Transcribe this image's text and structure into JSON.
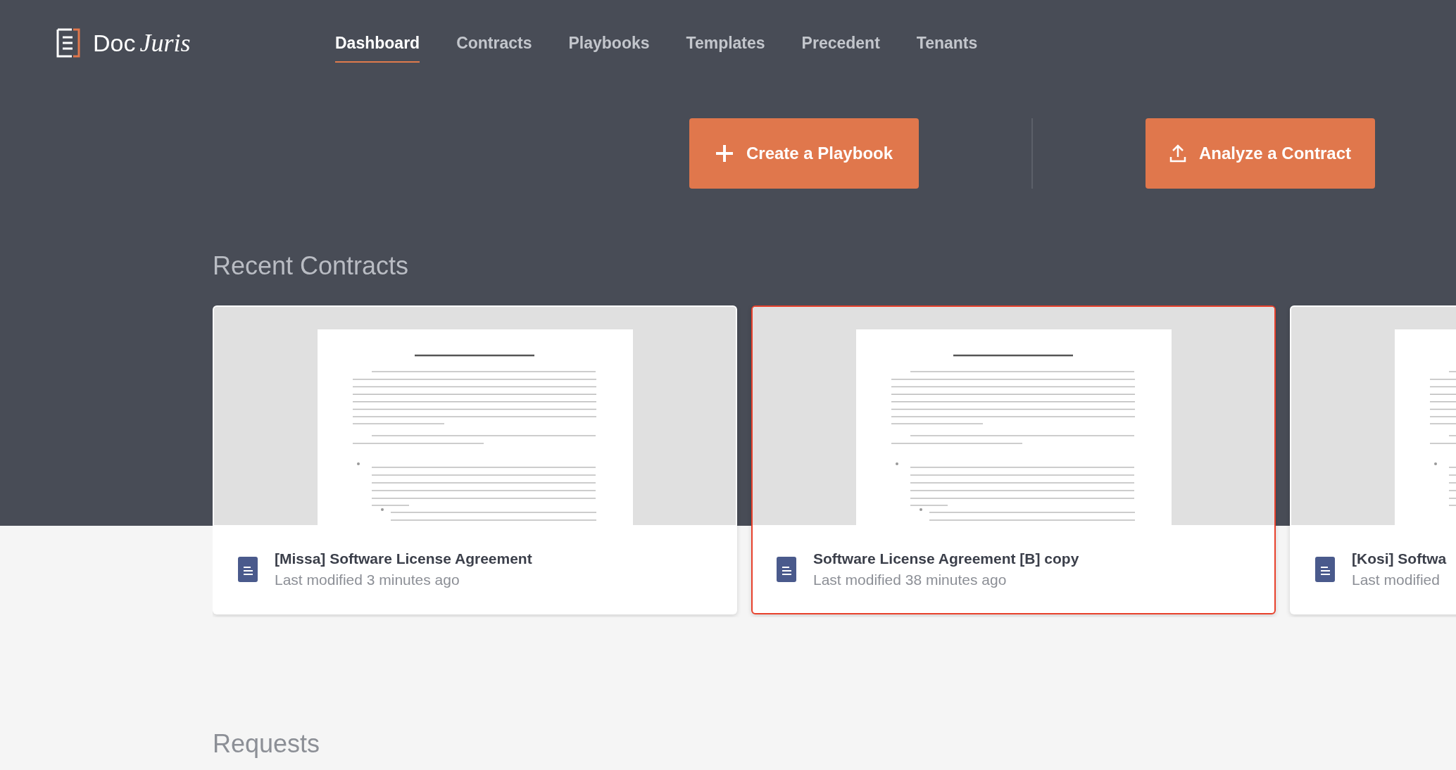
{
  "logo": {
    "first": "Doc",
    "second": "Juris"
  },
  "nav": [
    {
      "label": "Dashboard",
      "selected": true
    },
    {
      "label": "Contracts",
      "selected": false
    },
    {
      "label": "Playbooks",
      "selected": false
    },
    {
      "label": "Templates",
      "selected": false
    },
    {
      "label": "Precedent",
      "selected": false
    },
    {
      "label": "Tenants",
      "selected": false
    }
  ],
  "actions": [
    {
      "kind": "create",
      "label": "Create a Playbook"
    },
    {
      "kind": "upload",
      "label": "Analyze a Contract"
    }
  ],
  "recent_contracts": {
    "title": "Recent Contracts",
    "cards": [
      {
        "title": "[Missa] Software License Agreement",
        "subtitle": "Last modified 3 minutes ago",
        "selected": false
      },
      {
        "title": "Software License Agreement [B] copy",
        "subtitle": "Last modified 38 minutes ago",
        "selected": true
      },
      {
        "title": "[Kosi] Softwa",
        "subtitle": "Last modified",
        "selected": false
      }
    ]
  },
  "requests": {
    "title": "Requests"
  }
}
